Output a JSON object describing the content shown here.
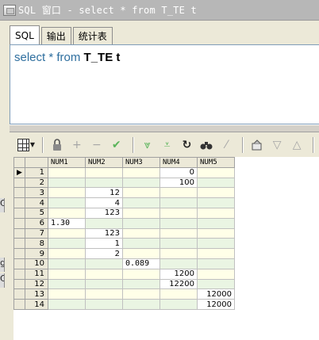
{
  "window": {
    "title": "SQL 窗口 - select * from T_TE t"
  },
  "tabs": [
    {
      "label": "SQL",
      "active": true
    },
    {
      "label": "输出",
      "active": false
    },
    {
      "label": "统计表",
      "active": false
    }
  ],
  "editor": {
    "kw_select": "select",
    "star": "*",
    "kw_from": "from",
    "table_name": "T_TE t"
  },
  "toolbar": {
    "icons": [
      "grid-menu-icon",
      "lock-icon",
      "add-record-icon",
      "delete-record-icon",
      "post-changes-icon",
      "fetch-next-icon",
      "fetch-last-icon",
      "refresh-icon",
      "find-icon",
      "clear-icon",
      "export-icon",
      "filter-down-icon",
      "filter-up-icon"
    ]
  },
  "grid": {
    "columns": [
      "NUM1",
      "NUM2",
      "NUM3",
      "NUM4",
      "NUM5"
    ],
    "current_row_marker": "▶",
    "rows": [
      {
        "n": "1",
        "cells": [
          "",
          "",
          "",
          "0",
          ""
        ]
      },
      {
        "n": "2",
        "cells": [
          "",
          "",
          "",
          "100",
          ""
        ]
      },
      {
        "n": "3",
        "cells": [
          "",
          "12",
          "",
          "",
          ""
        ]
      },
      {
        "n": "4",
        "cells": [
          "",
          "4",
          "",
          "",
          ""
        ]
      },
      {
        "n": "5",
        "cells": [
          "",
          "123",
          "",
          "",
          ""
        ]
      },
      {
        "n": "6",
        "cells": [
          "1.30",
          "",
          "",
          "",
          ""
        ]
      },
      {
        "n": "7",
        "cells": [
          "",
          "123",
          "",
          "",
          ""
        ]
      },
      {
        "n": "8",
        "cells": [
          "",
          "1",
          "",
          "",
          ""
        ]
      },
      {
        "n": "9",
        "cells": [
          "",
          "2",
          "",
          "",
          ""
        ]
      },
      {
        "n": "10",
        "cells": [
          "",
          "",
          "0.089",
          "",
          ""
        ]
      },
      {
        "n": "11",
        "cells": [
          "",
          "",
          "",
          "1200",
          ""
        ]
      },
      {
        "n": "12",
        "cells": [
          "",
          "",
          "",
          "12200",
          ""
        ]
      },
      {
        "n": "13",
        "cells": [
          "",
          "",
          "",
          "",
          "12000"
        ]
      },
      {
        "n": "14",
        "cells": [
          "",
          "",
          "",
          "",
          "12000"
        ]
      }
    ]
  },
  "left_artifacts": {
    "a1": "C",
    "a2": "g",
    "a3": "C"
  },
  "colors": {
    "cell_yellow": "#ffffe8",
    "cell_green": "#eaf5e3",
    "keyword": "#2f6f9f"
  }
}
